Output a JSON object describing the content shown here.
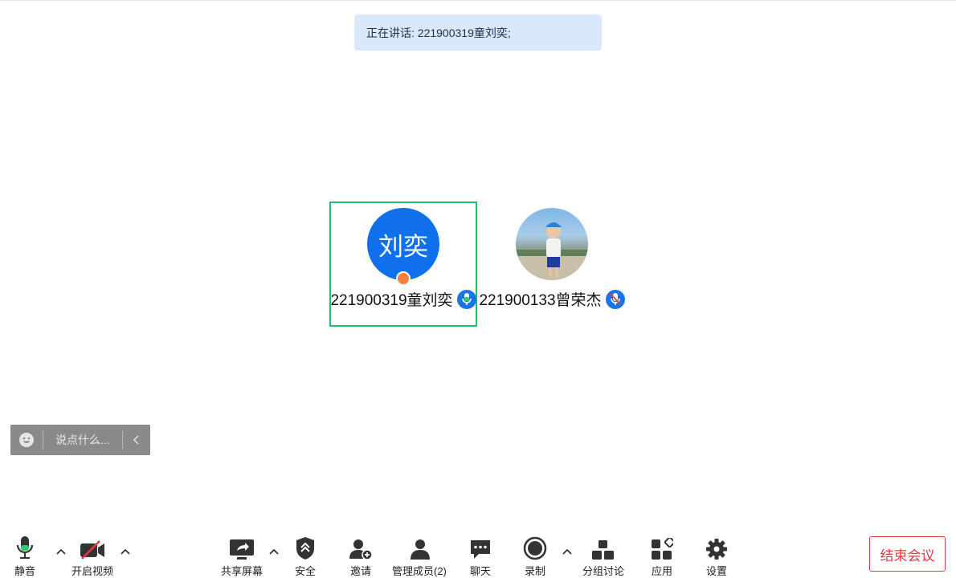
{
  "banner": {
    "text": "正在讲话: 221900319童刘奕;"
  },
  "participants": [
    {
      "avatar_text": "刘奕",
      "name": "221900319童刘奕",
      "speaking": true
    },
    {
      "avatar_text": "",
      "name": "221900133曾荣杰",
      "speaking": false
    }
  ],
  "chat": {
    "placeholder": "说点什么..."
  },
  "toolbar": {
    "mute_label": "静音",
    "video_label": "开启视频",
    "share_label": "共享屏幕",
    "security_label": "安全",
    "invite_label": "邀请",
    "members_label": "管理成员(2)",
    "chat_label": "聊天",
    "record_label": "录制",
    "breakout_label": "分组讨论",
    "apps_label": "应用",
    "settings_label": "设置",
    "end_label": "结束会议"
  },
  "colors": {
    "accent": "#0e71eb",
    "active_border": "#21c06b",
    "danger": "#e4393c",
    "banner_bg": "#d9e9fb",
    "host_badge": "#f5813d"
  }
}
